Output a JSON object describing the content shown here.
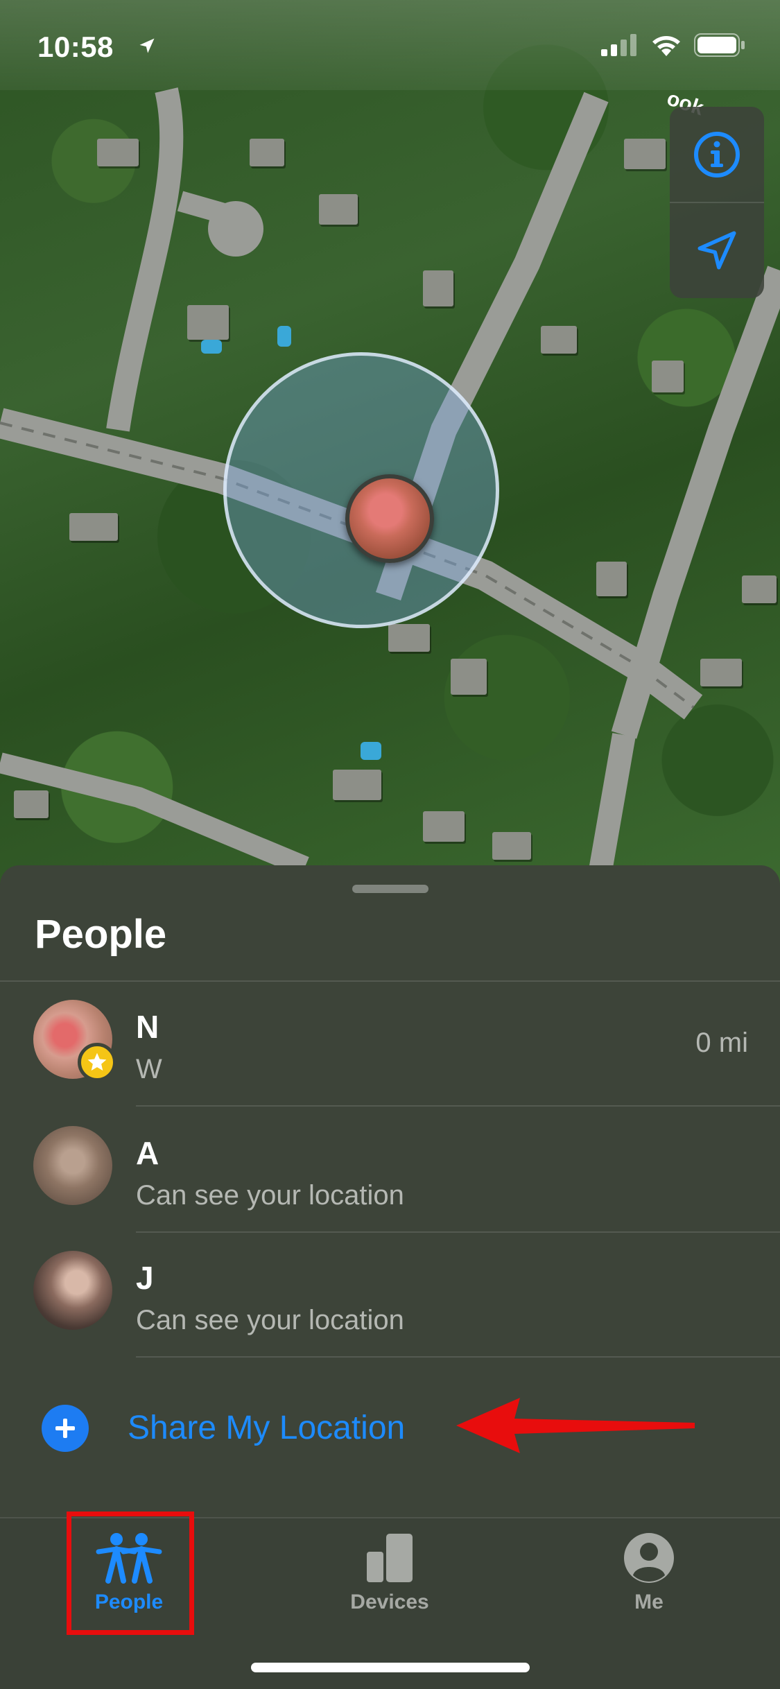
{
  "status_bar": {
    "time": "10:58"
  },
  "map": {
    "road_label": "ook"
  },
  "sheet": {
    "title": "People",
    "people": [
      {
        "name": "N",
        "subtitle": "W",
        "distance": "0 mi",
        "favorite": true
      },
      {
        "name": "A",
        "subtitle": "Can see your location",
        "distance": ""
      },
      {
        "name": "J",
        "subtitle": "Can see your location",
        "distance": ""
      }
    ],
    "share_label": "Share My Location"
  },
  "tabbar": {
    "tabs": [
      {
        "label": "People",
        "icon": "people-icon",
        "active": true
      },
      {
        "label": "Devices",
        "icon": "devices-icon",
        "active": false
      },
      {
        "label": "Me",
        "icon": "person-circle-icon",
        "active": false
      }
    ]
  },
  "colors": {
    "accent": "#1d8bff",
    "annotation_red": "#e80d0d",
    "favorite_star": "#f5c516"
  }
}
